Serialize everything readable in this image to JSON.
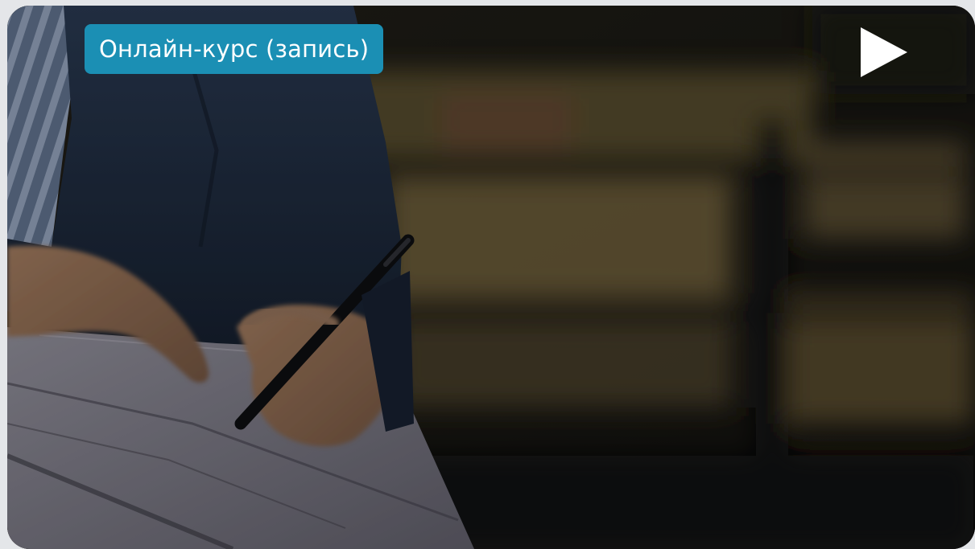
{
  "badge": {
    "label": "Онлайн-курс (запись)",
    "color": "#1b8fb4"
  },
  "media": {
    "play_icon": "play-icon",
    "image": "person-writing-in-notebook-photo"
  }
}
